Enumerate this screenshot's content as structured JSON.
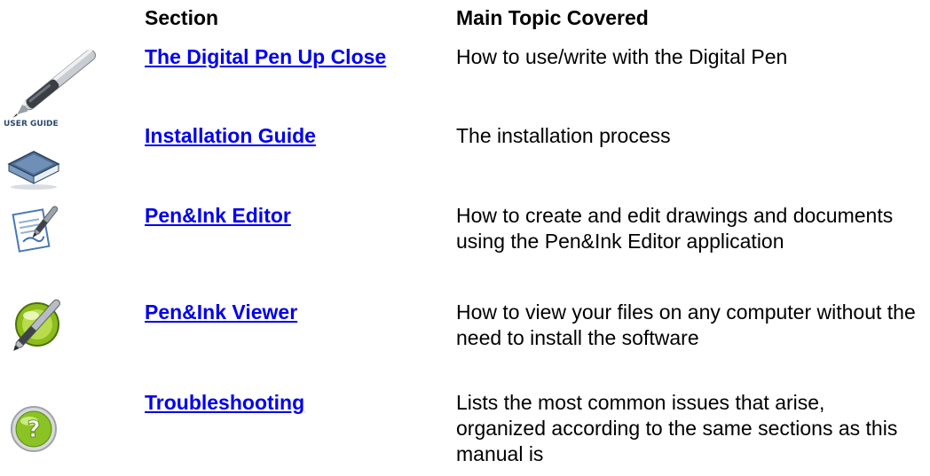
{
  "headers": {
    "section": "Section",
    "topic": "Main Topic Covered"
  },
  "rows": [
    {
      "icon": "digital-pen-icon",
      "link": "The Digital Pen Up Close",
      "description": "How to use/write with the Digital Pen"
    },
    {
      "icon": "user-guide-book-icon",
      "icon_text": "USER GUIDE",
      "link": "Installation Guide",
      "description": "The installation process"
    },
    {
      "icon": "pen-editor-document-icon",
      "link": "Pen&Ink Editor",
      "description": "How to create and edit drawings and documents using the Pen&Ink Editor application"
    },
    {
      "icon": "pen-viewer-circle-icon",
      "link": "Pen&Ink Viewer",
      "description": "How to view your files on any computer without the need to install the software"
    },
    {
      "icon": "question-mark-icon",
      "icon_text": "?",
      "link": "Troubleshooting",
      "description": "Lists the most common issues that arise, organized according to the same sections as this manual is"
    }
  ],
  "colors": {
    "link": "#0000ee",
    "text": "#000000"
  }
}
